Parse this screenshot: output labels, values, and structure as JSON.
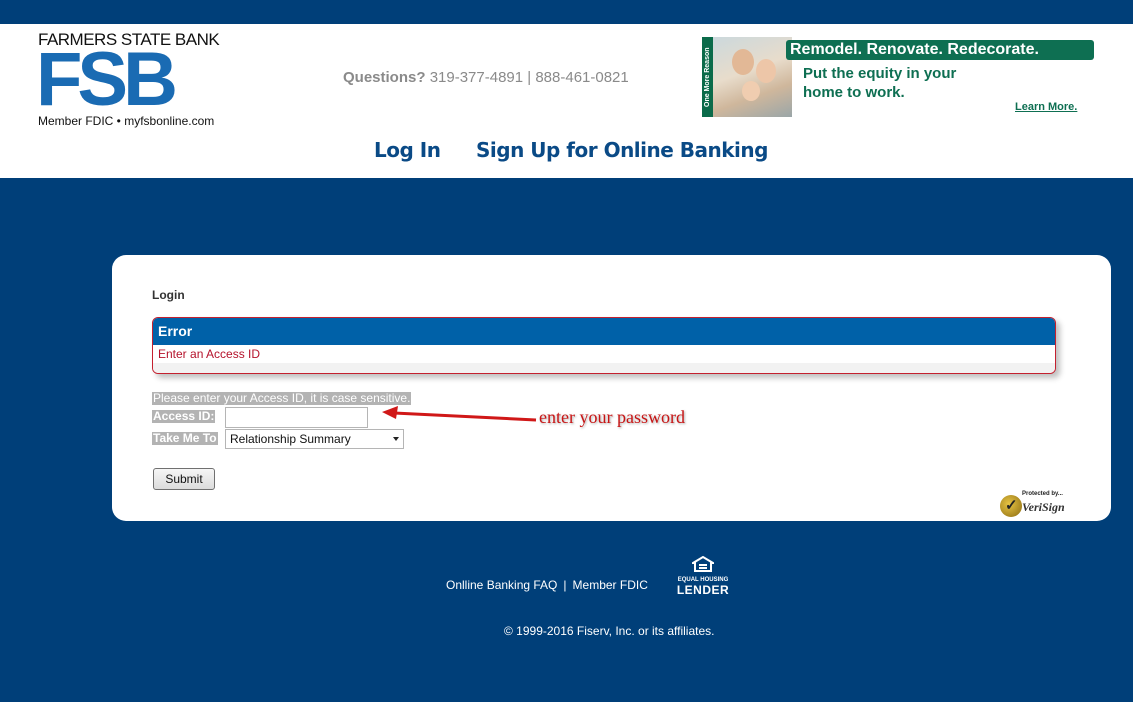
{
  "header": {
    "bank_name": "FARMERS STATE BANK",
    "logo_text": "FSB",
    "member_line": "Member FDIC • myfsbonline.com",
    "questions_label": "Questions?",
    "phones": "319-377-4891 | 888-461-0821"
  },
  "ad": {
    "side_text": "One More Reason",
    "headline": "Remodel. Renovate. Redecorate.",
    "line1": "Put the equity in your",
    "line2": "home to work.",
    "link": "Learn More."
  },
  "nav": {
    "login": "Log In",
    "signup": "Sign Up for Online Banking"
  },
  "login_panel": {
    "heading": "Login",
    "error_title": "Error",
    "error_message": "Enter an Access ID",
    "instructions": "Please enter your Access ID, it is case sensitive.",
    "access_id_label": "Access ID:",
    "access_id_value": "",
    "take_me_to_label": "Take Me To",
    "take_me_to_selected": "Relationship Summary",
    "submit_label": "Submit"
  },
  "annotation": {
    "text": "enter your password",
    "color": "#c81414"
  },
  "verisign": {
    "protected_by": "Protected by...",
    "name": "VeriSign"
  },
  "footer": {
    "faq_link": "Onlline Banking FAQ",
    "separator": "|",
    "fdic_link": "Member FDIC",
    "ehl_top": "EQUAL HOUSING",
    "ehl_bottom": "LENDER",
    "copyright": "© 1999-2016 Fiserv, Inc. or its affiliates."
  },
  "colors": {
    "brand_blue": "#003f79",
    "logo_blue": "#1a6bb3",
    "error_red": "#c4202f",
    "ad_green": "#0e6f52"
  }
}
